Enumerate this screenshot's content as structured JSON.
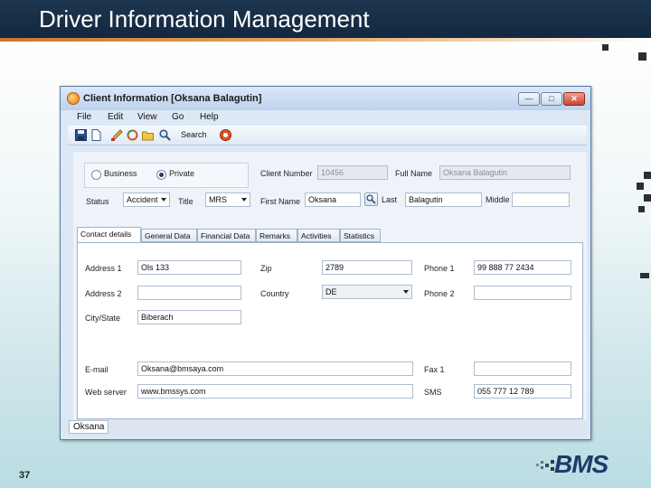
{
  "slide": {
    "title": "Driver Information Management",
    "number": "37",
    "logo_text": "BMS"
  },
  "window": {
    "title": "Client Information [Oksana Balagutin]",
    "buttons": {
      "minimize": "—",
      "maximize": "□",
      "close": "✕"
    }
  },
  "menu": [
    "File",
    "Edit",
    "View",
    "Go",
    "Help"
  ],
  "toolbar": {
    "search_label": "Search",
    "icons": [
      "save-icon",
      "new-document-icon",
      "edit-icon",
      "refresh-icon",
      "folder-icon",
      "search-icon",
      "help-icon"
    ]
  },
  "client_type": {
    "business_label": "Business",
    "private_label": "Private",
    "selected": "Private"
  },
  "header_fields": {
    "client_number_label": "Client Number",
    "client_number_value": "10456",
    "full_name_label": "Full Name",
    "full_name_value": "Oksana Balagutin",
    "status_label": "Status",
    "status_value": "Accident",
    "title_label": "Title",
    "title_value": "MRS",
    "first_name_label": "First Name",
    "first_name_value": "Oksana",
    "last_label": "Last",
    "last_value": "Balagutin",
    "middle_label": "Middle",
    "middle_value": ""
  },
  "tabs": [
    "Contact details",
    "General Data",
    "Financial Data",
    "Remarks",
    "Activities",
    "Statistics"
  ],
  "active_tab": "Contact details",
  "contact": {
    "address1_label": "Address 1",
    "address1_value": "Ols 133",
    "address2_label": "Address 2",
    "address2_value": "",
    "city_label": "City/State",
    "city_value": "Biberach",
    "zip_label": "Zip",
    "zip_value": "2789",
    "country_label": "Country",
    "country_value": "DE",
    "phone1_label": "Phone 1",
    "phone1_value": "99 888 77 2434",
    "phone2_label": "Phone 2",
    "phone2_value": "",
    "email_label": "E-mail",
    "email_value": "Oksana@bmsaya.com",
    "web_label": "Web server",
    "web_value": "www.bmssys.com",
    "fax_label": "Fax 1",
    "fax_value": "",
    "sms_label": "SMS",
    "sms_value": "055 777 12 789"
  },
  "status_bar": {
    "text": "Oksana"
  },
  "colors": {
    "header_bg": "#13283f",
    "accent_rule": "#c9762f",
    "window_border": "#5a7aa0",
    "close_button": "#c8452a"
  }
}
